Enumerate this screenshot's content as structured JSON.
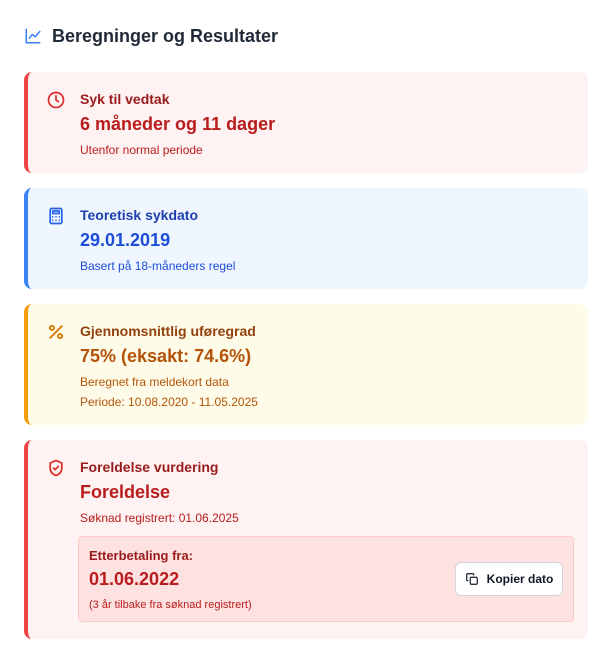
{
  "header": {
    "title": "Beregninger og Resultater",
    "icon": "line-chart-icon"
  },
  "cards": [
    {
      "icon": "clock-icon",
      "color": "#ef4444",
      "label": "Syk til vedtak",
      "value": "6 måneder og 11 dager",
      "lines": [
        "Utenfor normal periode"
      ]
    },
    {
      "icon": "calculator-icon",
      "color": "#3b82f6",
      "label": "Teoretisk sykdato",
      "value": "29.01.2019",
      "lines": [
        "Basert på 18-måneders regel"
      ]
    },
    {
      "icon": "percent-icon",
      "color": "#f59e0b",
      "label": "Gjennomsnittlig uføregrad",
      "value": "75% (eksakt: 74.6%)",
      "lines": [
        "Beregnet fra meldekort data",
        "Periode: 10.08.2020 - 11.05.2025"
      ]
    },
    {
      "icon": "shield-check-icon",
      "color": "#ef4444",
      "label": "Foreldelse vurdering",
      "value": "Foreldelse",
      "lines": [
        "Søknad registrert: 01.06.2025"
      ],
      "backpay": {
        "label": "Etterbetaling fra:",
        "value": "01.06.2022",
        "note": "(3 år tilbake fra søknad registrert)",
        "button_label": "Kopier dato",
        "button_icon": "copy-icon"
      }
    }
  ]
}
